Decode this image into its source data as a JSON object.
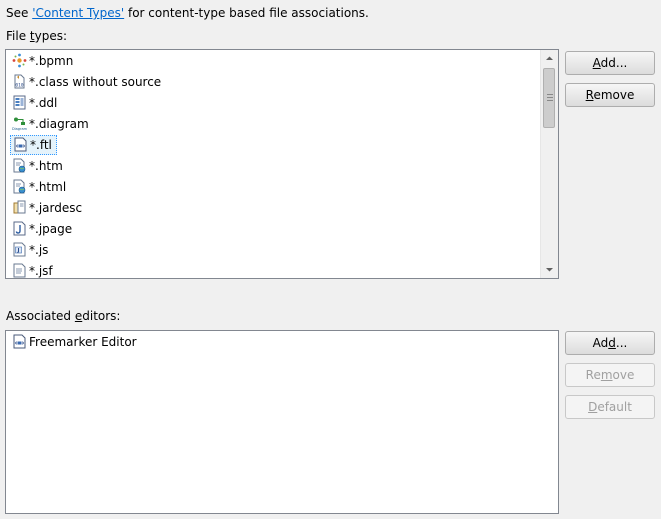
{
  "intro": {
    "prefix": "See ",
    "link": "'Content Types'",
    "suffix": " for content-type based file associations."
  },
  "file_types": {
    "label_pre": "File ",
    "label_u": "t",
    "label_post": "ypes:",
    "items": [
      {
        "label": "*.bpmn",
        "icon": "bpmn-icon"
      },
      {
        "label": "*.class without source",
        "icon": "class-file-icon"
      },
      {
        "label": "*.ddl",
        "icon": "ddl-icon"
      },
      {
        "label": "*.diagram",
        "icon": "diagram-icon"
      },
      {
        "label": "*.ftl",
        "icon": "freemarker-icon",
        "selected": true
      },
      {
        "label": "*.htm",
        "icon": "html-file-icon"
      },
      {
        "label": "*.html",
        "icon": "html-file-icon"
      },
      {
        "label": "*.jardesc",
        "icon": "jardesc-icon"
      },
      {
        "label": "*.jpage",
        "icon": "jpage-icon"
      },
      {
        "label": "*.js",
        "icon": "js-file-icon"
      },
      {
        "label": "*.jsf",
        "icon": "jsf-file-icon"
      }
    ],
    "icon_diagram_text": "Diagram",
    "icon_class_text": "010"
  },
  "file_buttons": {
    "add_pre": "",
    "add_u": "A",
    "add_post": "dd...",
    "remove_pre": "",
    "remove_u": "R",
    "remove_post": "emove"
  },
  "editors": {
    "label_pre": "Associated ",
    "label_u": "e",
    "label_post": "ditors:",
    "items": [
      {
        "label": "Freemarker Editor",
        "icon": "freemarker-icon"
      }
    ]
  },
  "editor_buttons": {
    "add_pre": "Ad",
    "add_u": "d",
    "add_post": "...",
    "remove_pre": "Re",
    "remove_u": "m",
    "remove_post": "ove",
    "default_pre": "",
    "default_u": "D",
    "default_post": "efault"
  },
  "colors": {
    "link": "#0066cc",
    "selection_bg": "#e5f3fb",
    "selection_border": "#3399ff",
    "disabled_text": "#a0a0a0"
  }
}
